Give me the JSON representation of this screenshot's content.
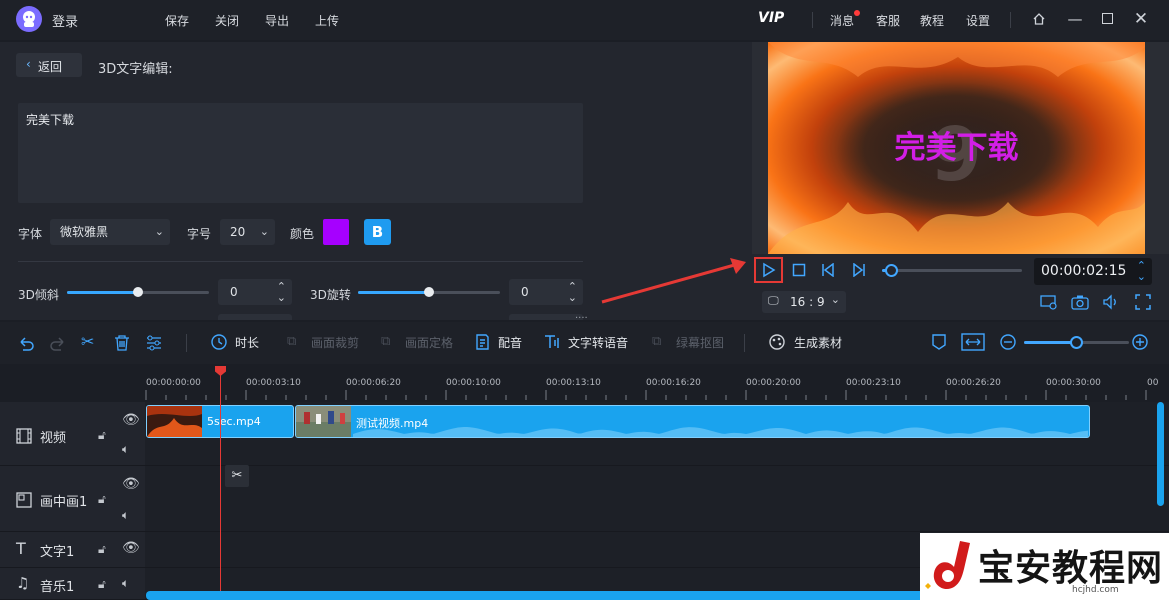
{
  "titlebar": {
    "login": "登录",
    "menu": [
      "保存",
      "关闭",
      "导出",
      "上传"
    ],
    "vip": "VIP",
    "right": [
      "消息",
      "客服",
      "教程",
      "设置"
    ]
  },
  "editor": {
    "back": "返回",
    "title": "3D文字编辑:",
    "text_value": "完美下载",
    "font_label": "字体",
    "font_value": "微软雅黑",
    "size_label": "字号",
    "size_value": "20",
    "color_label": "颜色",
    "color_value": "#a600ff",
    "bold_label": "B",
    "tilt_label": "3D倾斜",
    "tilt_value": "0",
    "tilt_level": 0.5,
    "rotate_label": "3D旋转",
    "rotate_value": "0",
    "rotate_level": 0.5,
    "more": "....",
    "accent": "#37a8ff"
  },
  "preview": {
    "overlay_text": "完美下载",
    "overlay_color": "#d21ee6",
    "aspect": "16 : 9",
    "time": "00:00:02:15",
    "progress": 0.07
  },
  "toolbar": {
    "items": [
      "时长",
      "画面裁剪",
      "画面定格",
      "配音",
      "文字转语音",
      "绿幕抠图",
      "生成素材"
    ],
    "zoom_level": 0.5
  },
  "timeline": {
    "ticks": [
      "00:00:00:00",
      "00:00:03:10",
      "00:00:06:20",
      "00:00:10:00",
      "00:00:13:10",
      "00:00:16:20",
      "00:00:20:00",
      "00:00:23:10",
      "00:00:26:20",
      "00:00:30:00"
    ],
    "tracks": [
      "视频",
      "画中画1",
      "文字1",
      "音乐1"
    ],
    "clips": [
      {
        "name": "5sec.mp4"
      },
      {
        "name": "测试视频.mp4"
      }
    ]
  },
  "watermark": {
    "text": "宝安教程网",
    "url": "hcjhd.com"
  }
}
